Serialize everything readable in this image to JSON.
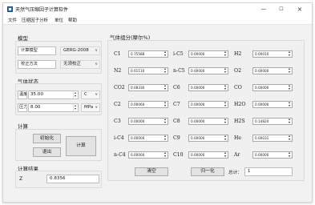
{
  "window": {
    "title": "天然气压缩因子计算软件",
    "controls": {
      "minimize": "—",
      "maximize": "☐",
      "close": "×"
    }
  },
  "menu": [
    "文件",
    "压缩因子分析",
    "单位",
    "帮助"
  ],
  "model_group": {
    "title": "模型",
    "calc_model_label": "计算模型",
    "calc_model_value": "GERG-2008",
    "correction_label": "校正方法",
    "correction_value": "无须校正"
  },
  "state_group": {
    "title": "气体状态",
    "temp_label": "温度",
    "temp_value": "35.00",
    "temp_unit": "C",
    "pressure_label": "压力",
    "pressure_value": "8.00",
    "pressure_unit": "MPa"
  },
  "calc_group": {
    "title": "计算",
    "init_button": "初始化",
    "calc_button": "计算",
    "exit_button": "退出"
  },
  "result_group": {
    "title": "计算结果",
    "z_label": "Z",
    "z_value": "0.8356"
  },
  "composition": {
    "title": "气体组分(摩尔%)",
    "columns": [
      [
        {
          "name": "C1",
          "value": "0.75588"
        },
        {
          "name": "N2",
          "value": "0.01110"
        },
        {
          "name": "CO2",
          "value": "0.08330"
        },
        {
          "name": "C2",
          "value": "0.00060"
        },
        {
          "name": "C3",
          "value": "0.00000"
        },
        {
          "name": "i-C4",
          "value": "0.00000"
        },
        {
          "name": "n-C4",
          "value": "0.00000"
        }
      ],
      [
        {
          "name": "i-C5",
          "value": "0.00000"
        },
        {
          "name": "n-C5",
          "value": "0.00000"
        },
        {
          "name": "C6",
          "value": "0.00000"
        },
        {
          "name": "C7",
          "value": "0.00000"
        },
        {
          "name": "C8",
          "value": "0.00000"
        },
        {
          "name": "C9",
          "value": "0.00000"
        },
        {
          "name": "C10",
          "value": "0.00000"
        }
      ],
      [
        {
          "name": "H2",
          "value": "0.00010"
        },
        {
          "name": "O2",
          "value": "0.00000"
        },
        {
          "name": "CO",
          "value": "0.00000"
        },
        {
          "name": "H2O",
          "value": "0.00000"
        },
        {
          "name": "H2S",
          "value": "0.14820"
        },
        {
          "name": "He",
          "value": "0.00031"
        },
        {
          "name": "Ar",
          "value": "0.00000"
        }
      ]
    ],
    "clear_button": "清空",
    "normalize_button": "归一化",
    "total_label": "总计：",
    "total_value": "1"
  }
}
